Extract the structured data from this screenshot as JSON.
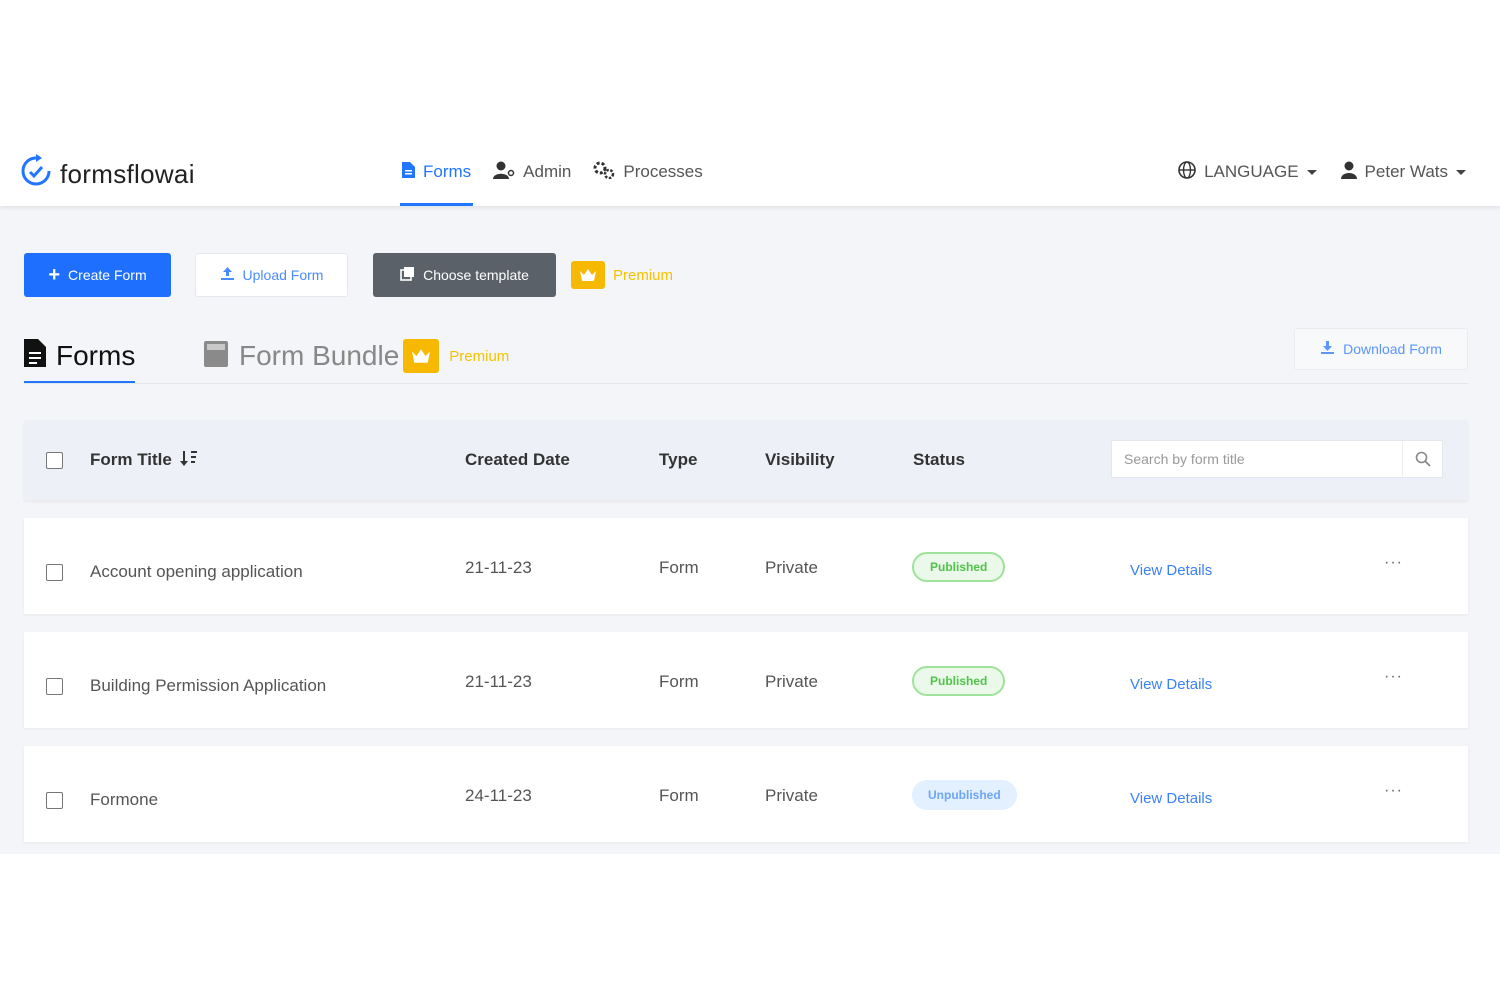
{
  "header": {
    "logo_text": "formsflowai",
    "nav": [
      {
        "label": "Forms",
        "icon": "document-icon",
        "active": true
      },
      {
        "label": "Admin",
        "icon": "user-gear-icon",
        "active": false
      },
      {
        "label": "Processes",
        "icon": "gears-icon",
        "active": false
      }
    ],
    "language_label": "LANGUAGE",
    "user_name": "Peter Wats"
  },
  "toolbar": {
    "create_label": "Create Form",
    "upload_label": "Upload Form",
    "template_label": "Choose template",
    "premium_label": "Premium"
  },
  "tabs": {
    "forms_label": "Forms",
    "bundle_label": "Form Bundle",
    "bundle_premium_label": "Premium",
    "download_label": "Download Form"
  },
  "table": {
    "columns": {
      "title": "Form Title",
      "created": "Created Date",
      "type": "Type",
      "visibility": "Visibility",
      "status": "Status"
    },
    "search_placeholder": "Search by form title",
    "view_details_label": "View Details",
    "more_label": "···",
    "rows": [
      {
        "title": "Account opening application",
        "created": "21-11-23",
        "type": "Form",
        "visibility": "Private",
        "status": "Published"
      },
      {
        "title": "Building Permission Application",
        "created": "21-11-23",
        "type": "Form",
        "visibility": "Private",
        "status": "Published"
      },
      {
        "title": "Formone",
        "created": "24-11-23",
        "type": "Form",
        "visibility": "Private",
        "status": "Unpublished"
      }
    ]
  },
  "colors": {
    "primary": "#1f6fff",
    "premium": "#f6b800",
    "published": "#52c24a",
    "unpublished": "#6ea5f5"
  }
}
